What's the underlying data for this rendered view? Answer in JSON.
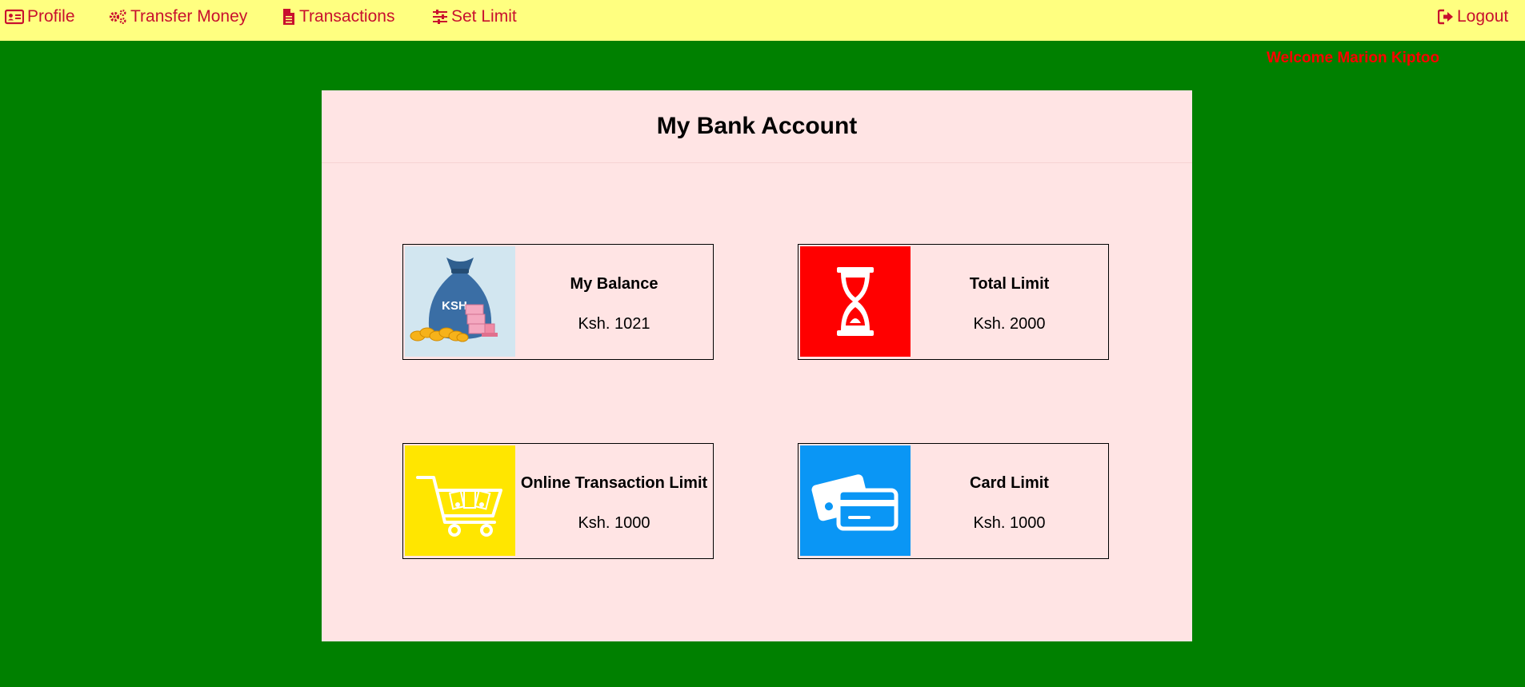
{
  "nav": {
    "profile": "Profile",
    "transfer": "Transfer Money",
    "transactions": "Transactions",
    "set_limit": "Set Limit",
    "logout": "Logout"
  },
  "welcome": "Welcome Marion Kiptoo",
  "panel": {
    "title": "My Bank Account"
  },
  "cards": {
    "balance": {
      "title": "My Balance",
      "value": "Ksh. 1021",
      "image_label": "KSH"
    },
    "total_limit": {
      "title": "Total Limit",
      "value": "Ksh. 2000"
    },
    "online_limit": {
      "title": "Online Transaction Limit",
      "value": "Ksh. 1000"
    },
    "card_limit": {
      "title": "Card Limit",
      "value": "Ksh. 1000"
    }
  },
  "icons": {
    "profile": "id-card-icon",
    "transfer": "gears-icon",
    "transactions": "document-icon",
    "set_limit": "sliders-icon",
    "logout": "sign-out-icon"
  },
  "colors": {
    "page_bg": "#008000",
    "nav_bg": "#ffff80",
    "nav_text": "#c8102e",
    "welcome_text": "#ff0000",
    "panel_bg": "#ffe4e4",
    "hourglass_bg": "#ff0000",
    "cart_bg": "#ffe600",
    "card_bg": "#0a96f5",
    "money_bag_bg": "#d2e6f0"
  }
}
